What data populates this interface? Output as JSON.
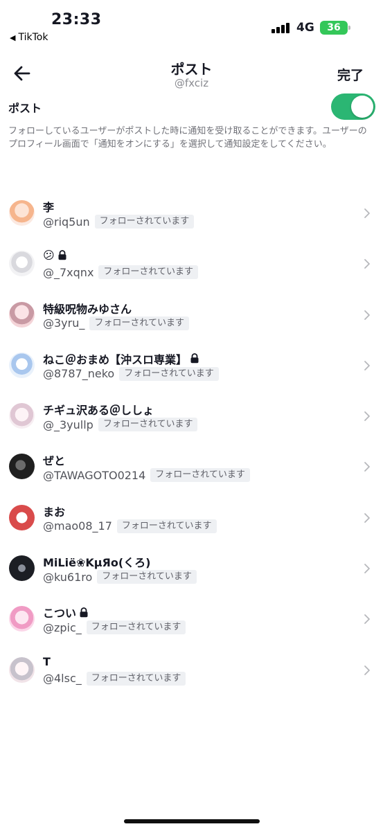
{
  "status_bar": {
    "time": "23:33",
    "back_app": "TikTok",
    "network": "4G",
    "battery": "36"
  },
  "header": {
    "title": "ポスト",
    "subtitle": "@fxciz",
    "done_label": "完了"
  },
  "toggle": {
    "label": "ポスト",
    "state": "on",
    "accent": "#2bb673"
  },
  "description": "フォローしているユーザーがポストした時に通知を受け取ることができます。ユーザーのプロフィール画面で「通知をオンにする」を選択して通知設定をしてください。",
  "users": [
    {
      "name": "李",
      "handle": "@riq5un",
      "badge": "フォローされています",
      "locked": false
    },
    {
      "name": "😕",
      "handle": "@_7xqnx",
      "badge": "フォローされています",
      "locked": true
    },
    {
      "name": "特級呪物みゆさん",
      "handle": "@3yru_",
      "badge": "フォローされています",
      "locked": false
    },
    {
      "name": "ねこ＠おまめ【沖スロ専業】",
      "handle": "@8787_neko",
      "badge": "フォローされています",
      "locked": true
    },
    {
      "name": "チギュ沢ある＠ししょ",
      "handle": "@_3yullp",
      "badge": "フォローされています",
      "locked": false
    },
    {
      "name": "ぜと",
      "handle": "@TAWAGOTO0214",
      "badge": "フォローされています",
      "locked": false
    },
    {
      "name": "まお",
      "handle": "@mao08_17",
      "badge": "フォローされています",
      "locked": false
    },
    {
      "name": "MiLië❀KμЯo(くろ)",
      "handle": "@ku61ro",
      "badge": "フォローされています",
      "locked": false
    },
    {
      "name": "こつい",
      "handle": "@zpic_",
      "badge": "フォローされています",
      "locked": true
    },
    {
      "name": "T",
      "handle": "@4lsc_",
      "badge": "フォローされています",
      "locked": false
    }
  ]
}
